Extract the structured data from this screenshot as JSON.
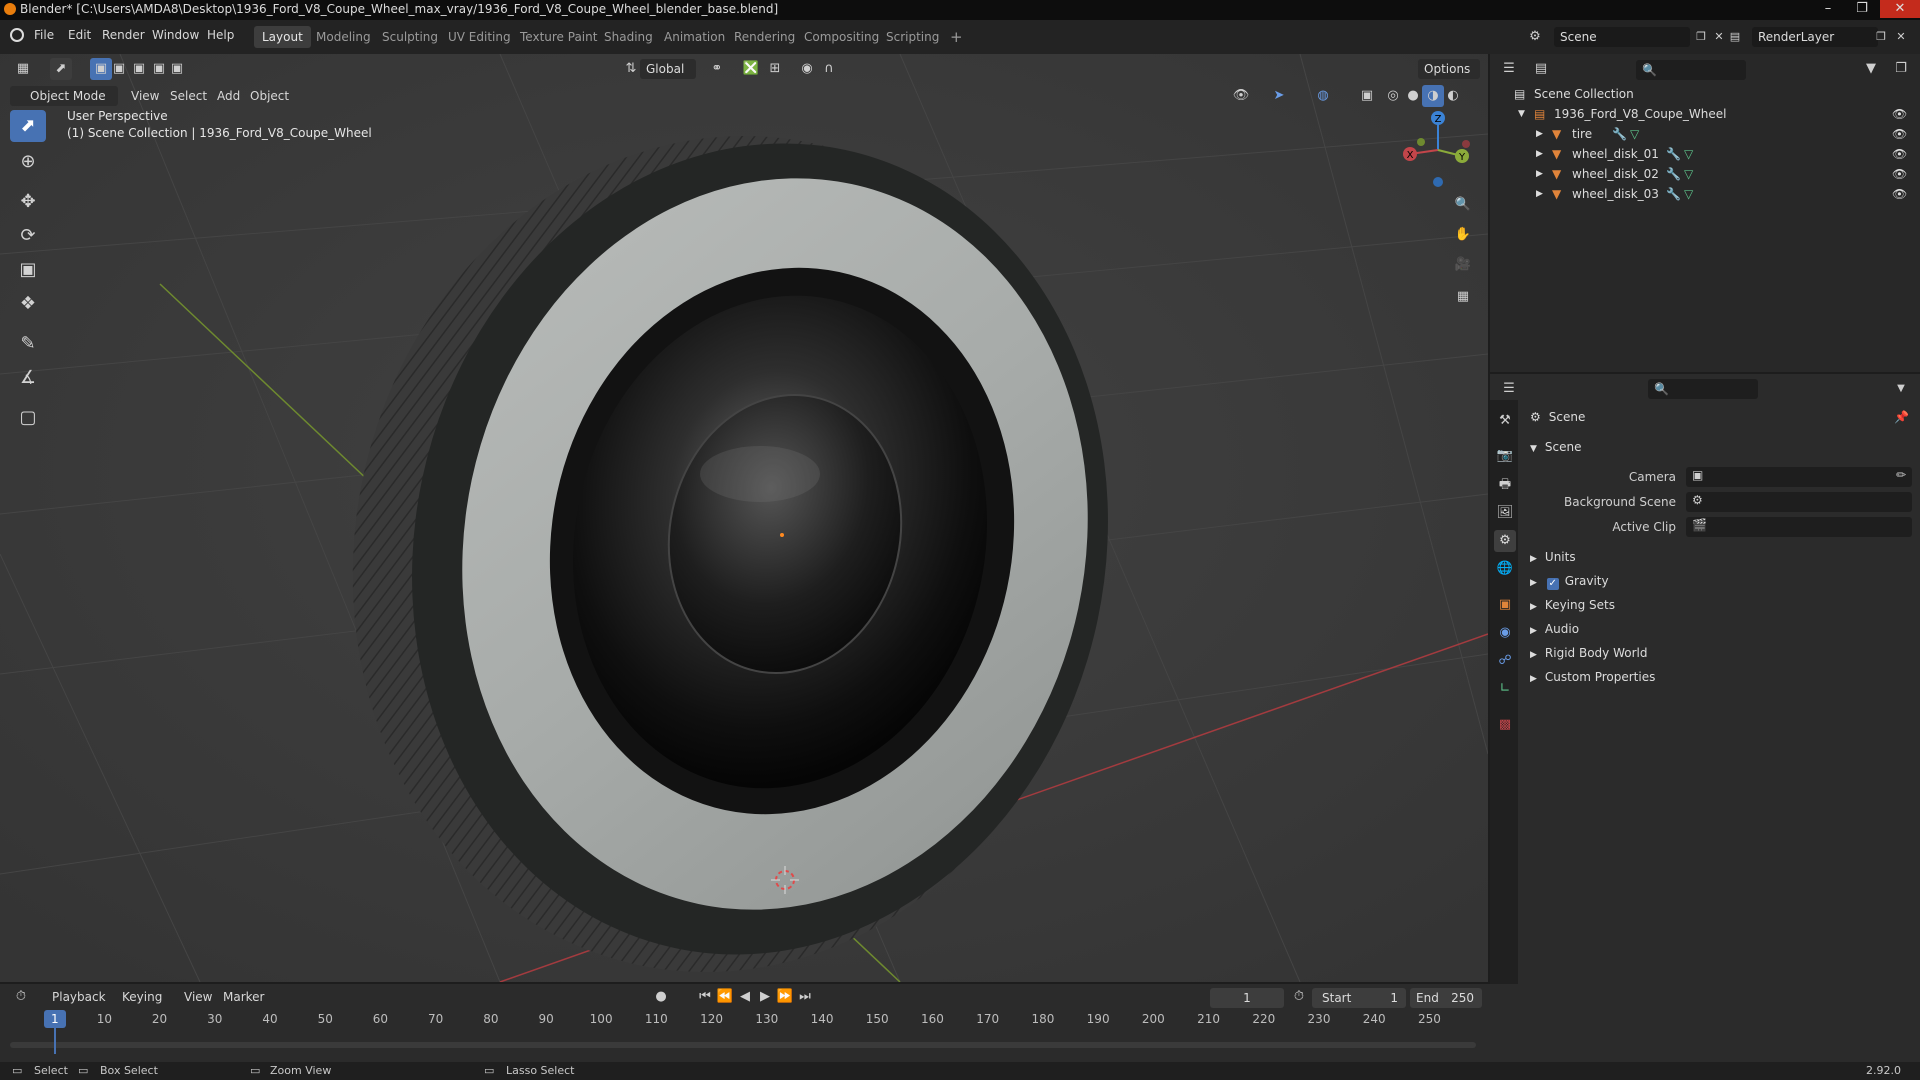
{
  "window": {
    "title": "Blender* [C:\\Users\\AMDA8\\Desktop\\1936_Ford_V8_Coupe_Wheel_max_vray/1936_Ford_V8_Coupe_Wheel_blender_base.blend]",
    "minimize": "–",
    "maximize": "❐",
    "close": "✕"
  },
  "menu": {
    "file": "File",
    "edit": "Edit",
    "render": "Render",
    "window": "Window",
    "help": "Help"
  },
  "workspaces": [
    {
      "label": "Layout",
      "active": true
    },
    {
      "label": "Modeling"
    },
    {
      "label": "Sculpting"
    },
    {
      "label": "UV Editing"
    },
    {
      "label": "Texture Paint"
    },
    {
      "label": "Shading"
    },
    {
      "label": "Animation"
    },
    {
      "label": "Rendering"
    },
    {
      "label": "Compositing"
    },
    {
      "label": "Scripting"
    },
    {
      "label": "+"
    }
  ],
  "scene_selector": {
    "value": "Scene"
  },
  "renderlayer_selector": {
    "value": "RenderLayer"
  },
  "viewport": {
    "mode": "Object Mode",
    "menus": {
      "view": "View",
      "select": "Select",
      "add": "Add",
      "object": "Object"
    },
    "orientation": "Global",
    "options": "Options",
    "overlay_line1": "User Perspective",
    "overlay_line2": "(1) Scene Collection | 1936_Ford_V8_Coupe_Wheel",
    "gizmo": {
      "x": "X",
      "y": "Y",
      "z": "Z"
    }
  },
  "outliner": {
    "root": "Scene Collection",
    "collection": "1936_Ford_V8_Coupe_Wheel",
    "items": [
      {
        "name": "tire"
      },
      {
        "name": "wheel_disk_01"
      },
      {
        "name": "wheel_disk_02"
      },
      {
        "name": "wheel_disk_03"
      }
    ]
  },
  "properties": {
    "context": "Scene",
    "panel": "Scene",
    "camera_label": "Camera",
    "background_scene_label": "Background Scene",
    "active_clip_label": "Active Clip",
    "sections": [
      {
        "label": "Units",
        "checkbox": false
      },
      {
        "label": "Gravity",
        "checkbox": true
      },
      {
        "label": "Keying Sets",
        "checkbox": false
      },
      {
        "label": "Audio",
        "checkbox": false
      },
      {
        "label": "Rigid Body World",
        "checkbox": false
      },
      {
        "label": "Custom Properties",
        "checkbox": false
      }
    ]
  },
  "timeline": {
    "playback": "Playback",
    "keying": "Keying",
    "view": "View",
    "marker": "Marker",
    "current_frame": "1",
    "start_label": "Start",
    "start": "1",
    "end_label": "End",
    "end": "250",
    "ticks": [
      "1",
      "10",
      "20",
      "30",
      "40",
      "50",
      "60",
      "70",
      "80",
      "90",
      "100",
      "110",
      "120",
      "130",
      "140",
      "150",
      "160",
      "170",
      "180",
      "190",
      "200",
      "210",
      "220",
      "230",
      "240",
      "250"
    ]
  },
  "statusbar": {
    "select": "Select",
    "box_select": "Box Select",
    "zoom_view": "Zoom View",
    "lasso_select": "Lasso Select",
    "version": "2.92.0"
  },
  "colors": {
    "accent": "#4772b3",
    "viewport_bg": "#393939",
    "x_axis": "#c3454a",
    "y_axis": "#8bab3a",
    "z_axis": "#3b83d6",
    "object_icon": "#e0843a"
  }
}
